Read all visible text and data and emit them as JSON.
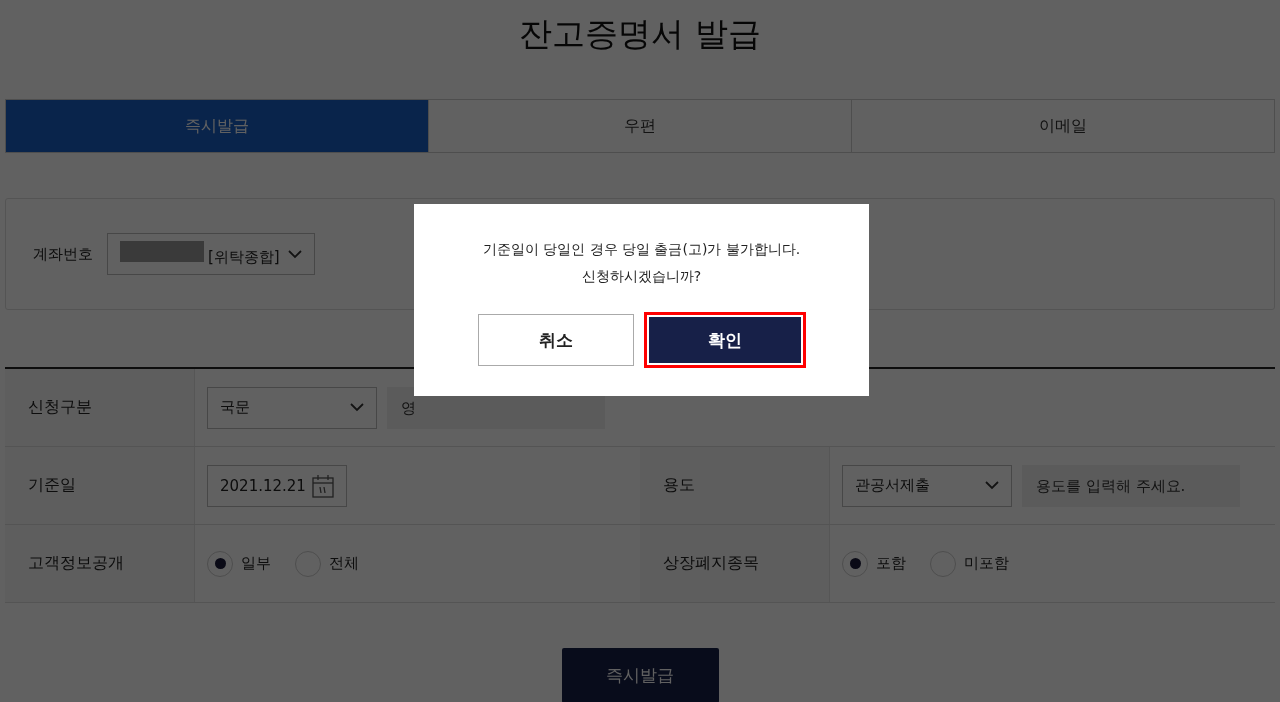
{
  "page": {
    "title": "잔고증명서 발급"
  },
  "tabs": [
    {
      "label": "즉시발급",
      "selected": true
    },
    {
      "label": "우편",
      "selected": false
    },
    {
      "label": "이메일",
      "selected": false
    }
  ],
  "account": {
    "label": "계좌번호",
    "value": "[위탁종합]",
    "masked": true
  },
  "form": {
    "rows": [
      {
        "label": "신청구분",
        "cells": [
          {
            "kind": "select",
            "value": "국문"
          },
          {
            "kind": "input",
            "placeholder": "영"
          }
        ]
      },
      {
        "label": "기준일",
        "cells": [
          {
            "kind": "date",
            "value": "2021.12.21"
          }
        ],
        "label_2": "용도",
        "cells_2": [
          {
            "kind": "select",
            "value": "관공서제출"
          },
          {
            "kind": "input",
            "placeholder": "용도를 입력해 주세요."
          }
        ]
      },
      {
        "label": "고객정보공개",
        "cells": [
          {
            "kind": "radio",
            "options": [
              {
                "label": "일부",
                "selected": true
              },
              {
                "label": "전체",
                "selected": false
              }
            ]
          }
        ],
        "label_2": "상장폐지종목",
        "cells_2": [
          {
            "kind": "radio",
            "options": [
              {
                "label": "포함",
                "selected": true
              },
              {
                "label": "미포함",
                "selected": false
              }
            ]
          }
        ]
      }
    ]
  },
  "submit_button": "즉시발급",
  "dialog": {
    "open": true,
    "message": [
      "기준일이 당일인 경우 당일 출금(고)가 불가합니다.",
      "신청하시겠습니까?"
    ],
    "buttons": [
      {
        "label": "취소",
        "kind": "secondary",
        "highlighted": false
      },
      {
        "label": "확인",
        "kind": "primary",
        "highlighted": true
      }
    ]
  }
}
